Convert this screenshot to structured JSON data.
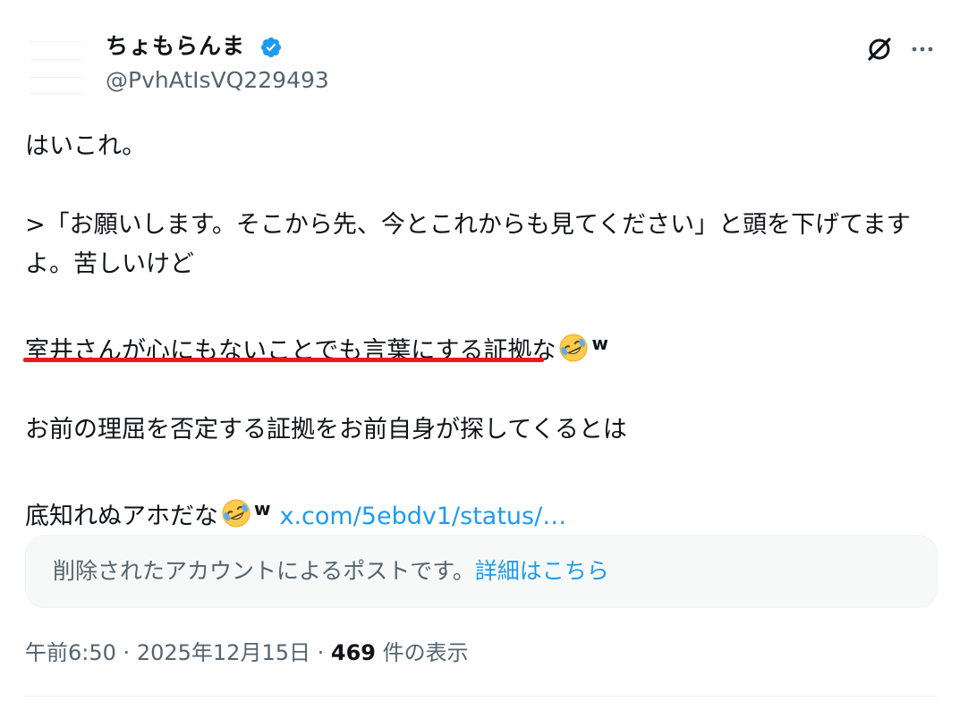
{
  "author": {
    "display_name": "ちょもらんま",
    "handle": "@PvhAtIsVQ229493",
    "verified": true,
    "verified_badge_color": "#1d9bf0"
  },
  "actions": {
    "grok_icon": "grok-icon",
    "more_icon": "more-icon"
  },
  "post": {
    "line1": "はいこれ。",
    "quote_line": ">「お願いします。そこから先、今とこれからも見てください」と頭を下げてますよ。苦しいけど",
    "highlight_line": "室井さんが心にもないことでも言葉にする証拠なｗ",
    "highlight_underlined": "室井さんが心にもないことでも言葉にする",
    "highlight_rest": "証拠な",
    "line4": "お前の理屈を否定する証拠をお前自身が探してくるとは",
    "line5": "底知れぬアホだな",
    "w_suffix": "w",
    "emoji": "rolling-on-floor-laughing-emoji",
    "link": "x.com/5ebdv1/status/…",
    "highlight_color": "#e81b1b"
  },
  "notice": {
    "text": "削除されたアカウントによるポストです。",
    "link": "詳細はこちら"
  },
  "meta": {
    "time": "午前6:50",
    "separator": "·",
    "date": "2025年12月15日",
    "views_count": "469",
    "views_label": "件の表示"
  },
  "colors": {
    "text": "#0f1419",
    "secondary": "#536471",
    "accent": "#1d9bf0"
  }
}
